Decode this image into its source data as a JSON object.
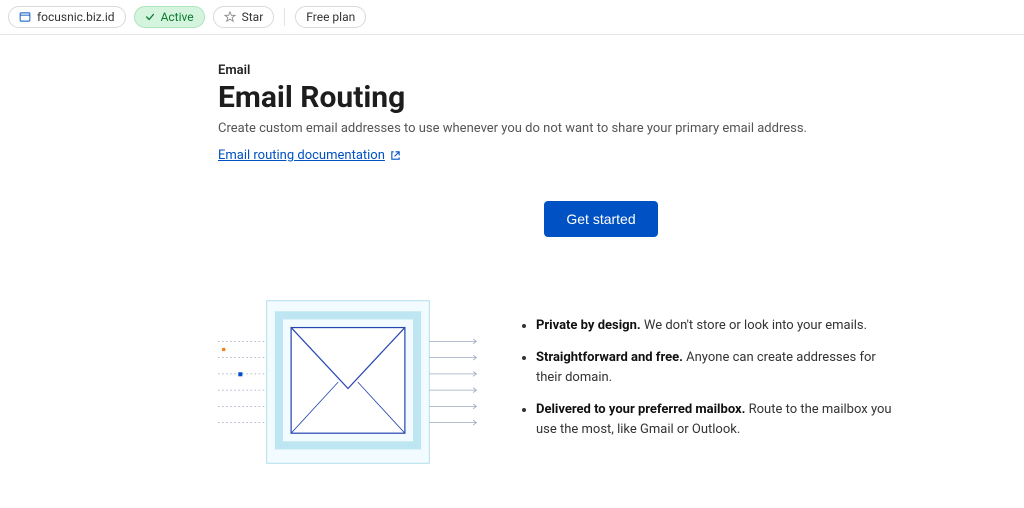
{
  "topbar": {
    "domain": "focusnic.biz.id",
    "status": "Active",
    "star": "Star",
    "plan": "Free plan"
  },
  "page": {
    "breadcrumb": "Email",
    "title": "Email Routing",
    "subtitle": "Create custom email addresses to use whenever you do not want to share your primary email address.",
    "docLink": "Email routing documentation"
  },
  "cta": {
    "getStarted": "Get started"
  },
  "features": [
    {
      "bold": "Private by design.",
      "rest": " We don't store or look into your emails."
    },
    {
      "bold": "Straightforward and free.",
      "rest": " Anyone can create addresses for their domain."
    },
    {
      "bold": "Delivered to your preferred mailbox.",
      "rest": " Route to the mailbox you use the most, like Gmail or Outlook."
    }
  ]
}
